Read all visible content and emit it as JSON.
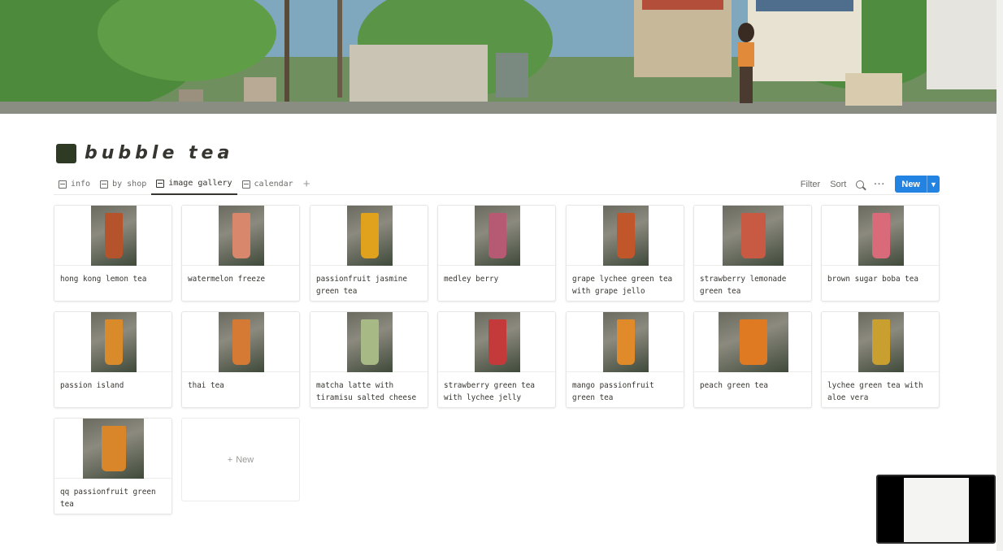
{
  "page": {
    "title": "bubble tea"
  },
  "tabs": [
    {
      "label": "info",
      "icon": "table-icon"
    },
    {
      "label": "by shop",
      "icon": "board-icon"
    },
    {
      "label": "image gallery",
      "icon": "gallery-icon",
      "active": true
    },
    {
      "label": "calendar",
      "icon": "calendar-icon"
    }
  ],
  "toolbar": {
    "filter_label": "Filter",
    "sort_label": "Sort",
    "new_label": "New"
  },
  "gallery": {
    "cards": [
      {
        "title": "hong kong lemon tea",
        "color": "#b5532d"
      },
      {
        "title": "watermelon freeze",
        "color": "#d9876c"
      },
      {
        "title": "passionfruit jasmine green tea",
        "color": "#e0a21d"
      },
      {
        "title": "medley berry",
        "color": "#b65a73"
      },
      {
        "title": "grape lychee green tea with grape jello",
        "color": "#c0562a"
      },
      {
        "title": "strawberry lemonade green tea",
        "color": "#c85a44"
      },
      {
        "title": "brown sugar boba tea",
        "color": "#d86a7a"
      },
      {
        "title": "passion island",
        "color": "#d98a2a"
      },
      {
        "title": "thai tea",
        "color": "#d47a34"
      },
      {
        "title": "matcha latte with tiramisu salted cheese",
        "color": "#a7b985"
      },
      {
        "title": "strawberry green tea with lychee jelly",
        "color": "#c43a3a"
      },
      {
        "title": "mango passionfruit green tea",
        "color": "#e08a2a"
      },
      {
        "title": "peach green tea",
        "color": "#e07a22"
      },
      {
        "title": "lychee green tea with aloe vera",
        "color": "#c9a030"
      },
      {
        "title": "qq passionfruit green tea",
        "color": "#d9852a"
      }
    ],
    "new_card_label": "New"
  }
}
